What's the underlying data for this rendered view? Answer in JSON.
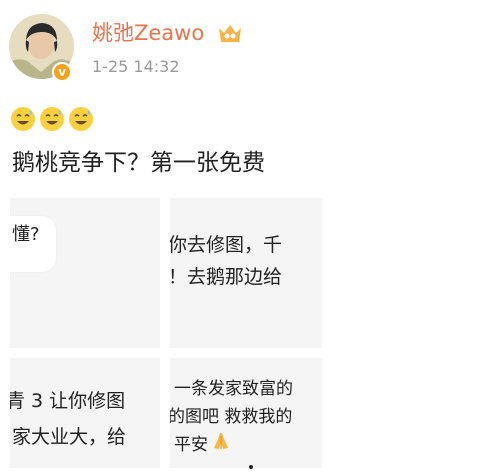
{
  "post": {
    "author": "姚弛Zeawo",
    "timestamp": "1-25 14:32",
    "verified_badge": "v",
    "text": "鹅桃竞争下？第一张免费",
    "emoji_count": 3,
    "emoji_icon": "grinning-sweat-face-icon"
  },
  "images": {
    "tile1_text": "懂?",
    "tile2_line1": "你去修图，千",
    "tile2_line2": "！去鹅那边给",
    "tile3_line1": "青 3 让你修图",
    "tile3_line2": "家大业大，给",
    "tile4_line1": "一条发家致富的",
    "tile4_line2": "的图吧 救救我的",
    "tile4_line3": "平安"
  },
  "colors": {
    "username": "#eb7350",
    "verified": "#f7a01a",
    "timestamp": "#9a9a9a",
    "tile_bg": "#f5f5f5"
  }
}
